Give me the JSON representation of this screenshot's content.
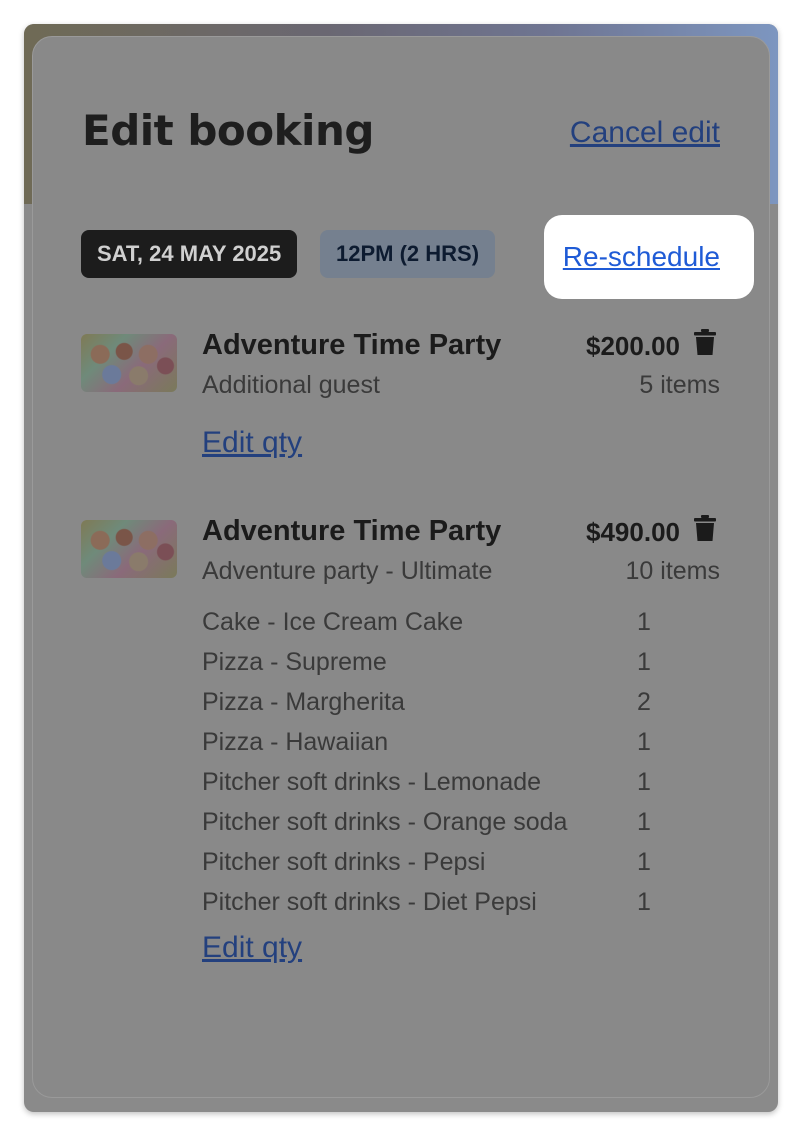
{
  "header": {
    "title": "Edit booking",
    "cancel_label": "Cancel edit"
  },
  "booking": {
    "date_chip": "SAT, 24 MAY 2025",
    "time_chip": "12PM (2 HRS)",
    "reschedule_label": "Re-schedule"
  },
  "items": [
    {
      "name": "Adventure Time Party",
      "subtitle": "Additional guest",
      "price": "$200.00",
      "count": "5 items",
      "edit_label": "Edit qty",
      "icon": "trash-icon"
    },
    {
      "name": "Adventure Time Party",
      "subtitle": "Adventure party - Ultimate",
      "price": "$490.00",
      "count": "10 items",
      "edit_label": "Edit qty",
      "icon": "trash-icon",
      "lines": [
        {
          "label": "Cake - Ice Cream Cake",
          "qty": "1"
        },
        {
          "label": "Pizza - Supreme",
          "qty": "1"
        },
        {
          "label": "Pizza - Margherita",
          "qty": "2"
        },
        {
          "label": "Pizza - Hawaiian",
          "qty": "1"
        },
        {
          "label": "Pitcher soft drinks - Lemonade",
          "qty": "1"
        },
        {
          "label": "Pitcher soft drinks - Orange soda",
          "qty": "1"
        },
        {
          "label": "Pitcher soft drinks - Pepsi",
          "qty": "1"
        },
        {
          "label": "Pitcher soft drinks - Diet Pepsi",
          "qty": "1"
        }
      ]
    }
  ],
  "colors": {
    "overlay": "#898989",
    "link": "#23407e",
    "highlight_link": "#1f5bd6"
  }
}
